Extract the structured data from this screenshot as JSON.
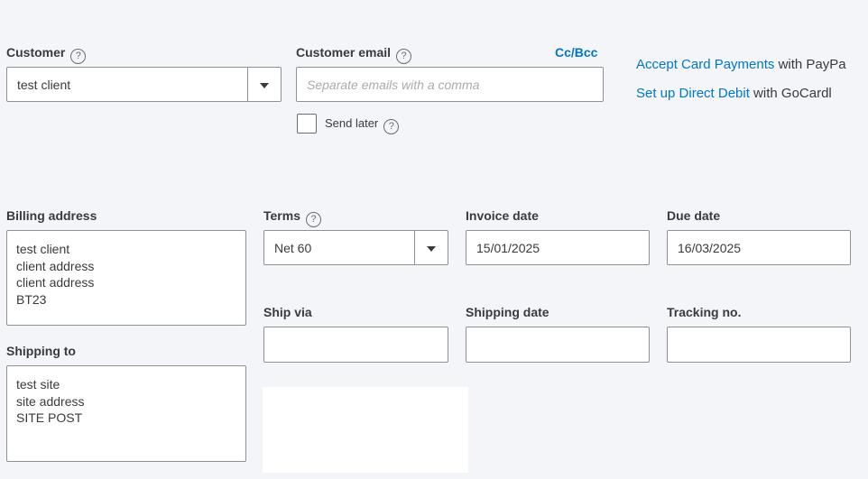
{
  "customer": {
    "label": "Customer",
    "value": "test client"
  },
  "customer_email": {
    "label": "Customer email",
    "placeholder": "Separate emails with a comma",
    "ccbcc": "Cc/Bcc"
  },
  "send_later": {
    "label": "Send later",
    "checked": false
  },
  "payments": {
    "card_link": "Accept Card Payments",
    "card_suffix": " with PayPa",
    "debit_link": "Set up Direct Debit",
    "debit_suffix": " with GoCardl"
  },
  "billing_address": {
    "label": "Billing address",
    "lines": [
      "test client",
      "client address",
      "client address",
      "BT23"
    ]
  },
  "shipping_to": {
    "label": "Shipping to",
    "lines": [
      "test site",
      "site address",
      "SITE POST"
    ]
  },
  "terms": {
    "label": "Terms",
    "value": "Net 60"
  },
  "invoice_date": {
    "label": "Invoice date",
    "value": "15/01/2025"
  },
  "due_date": {
    "label": "Due date",
    "value": "16/03/2025"
  },
  "ship_via": {
    "label": "Ship via",
    "value": ""
  },
  "shipping_date": {
    "label": "Shipping date",
    "value": ""
  },
  "tracking_no": {
    "label": "Tracking no.",
    "value": ""
  },
  "icons": {
    "help": "?"
  },
  "colors": {
    "background": "#f4f5f8",
    "link": "#0077c5",
    "border": "#8d9096"
  }
}
